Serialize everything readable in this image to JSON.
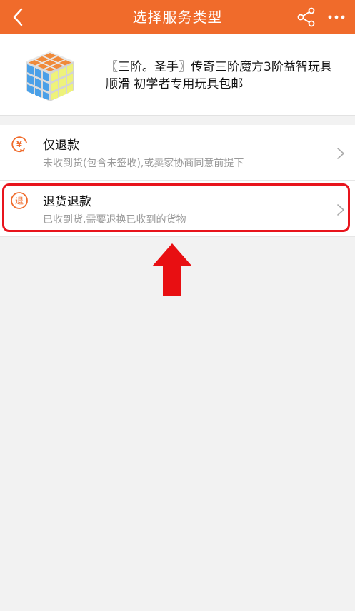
{
  "nav": {
    "title": "选择服务类型",
    "back_icon": "back-chevron-icon",
    "share_icon": "share-icon",
    "more_icon": "more-dots-icon",
    "bar_color": "#f06b2b"
  },
  "product": {
    "title": "〖三阶。圣手〗传奇三阶魔方3阶益智玩具顺滑 初学者专用玩具包邮",
    "image": "rubiks-cube-image"
  },
  "options": [
    {
      "title": "仅退款",
      "desc": "未收到货(包含未签收),或卖家协商同意前提下",
      "icon": "yen-refund-icon"
    },
    {
      "title": "退货退款",
      "desc": "已收到货,需要退换已收到的货物",
      "icon": "return-goods-icon"
    }
  ],
  "annotation": {
    "highlight_color": "#e8141c",
    "arrow_icon": "up-arrow-icon"
  }
}
